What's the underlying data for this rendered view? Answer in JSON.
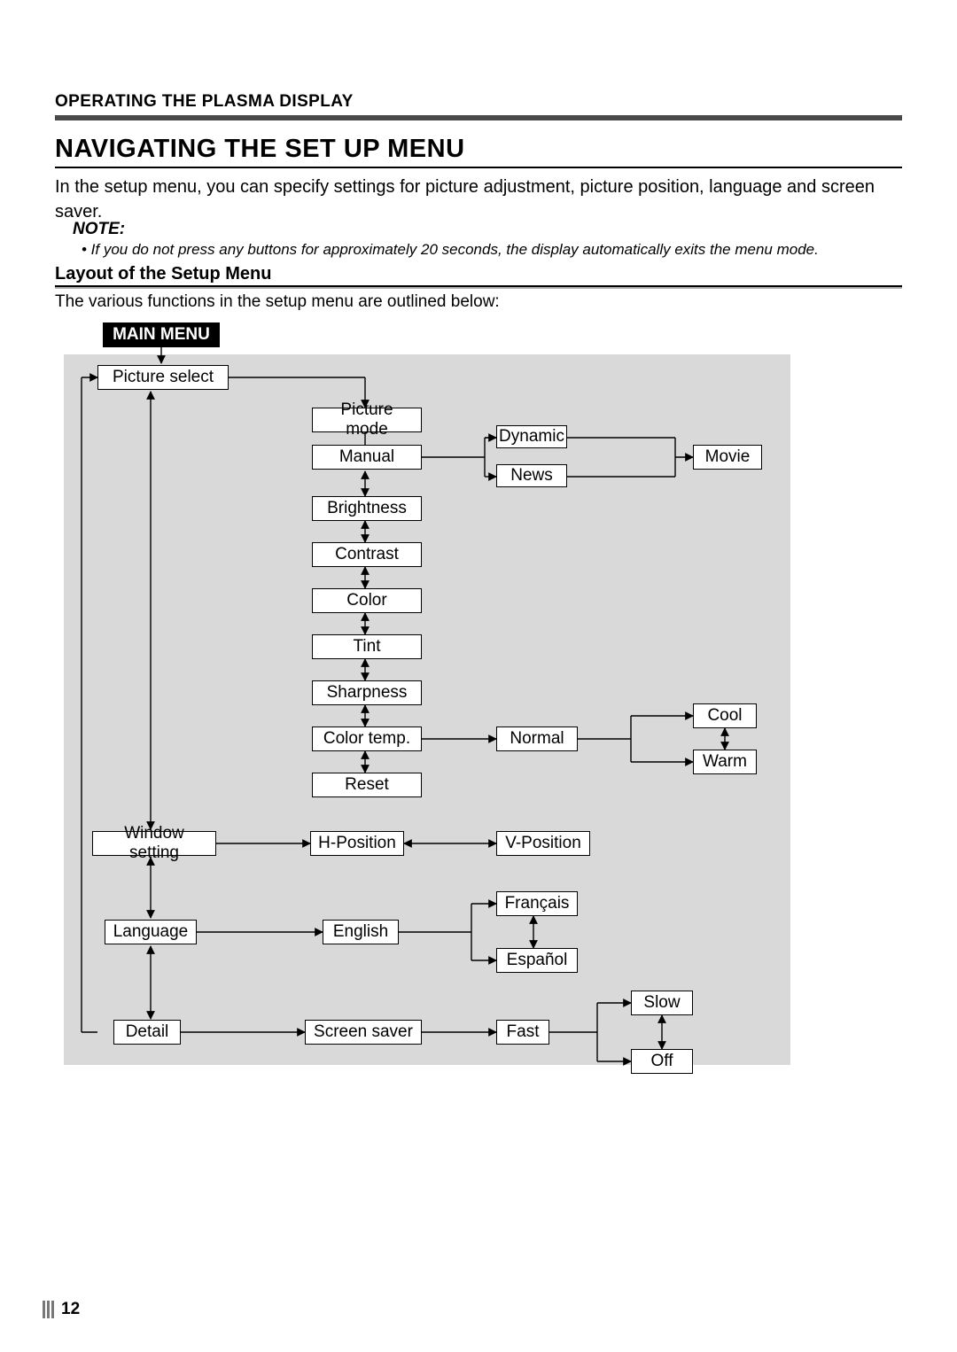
{
  "header": {
    "section": "OPERATING THE PLASMA DISPLAY",
    "title": "NAVIGATING THE SET UP MENU",
    "intro": "In the setup menu, you can specify settings for picture adjustment, picture position, language and screen saver.",
    "note_label": "NOTE:",
    "note_body": "• If you do not press any buttons for approximately 20 seconds, the display automatically exits the menu mode.",
    "h2": "Layout of the Setup Menu",
    "outline": "The various functions in the setup menu are outlined below:"
  },
  "nodes": {
    "main_menu": "MAIN MENU",
    "picture_select": "Picture select",
    "picture_mode": "Picture mode",
    "manual": "Manual",
    "dynamic": "Dynamic",
    "news": "News",
    "movie": "Movie",
    "brightness": "Brightness",
    "contrast": "Contrast",
    "color": "Color",
    "tint": "Tint",
    "sharpness": "Sharpness",
    "color_temp": "Color temp.",
    "normal": "Normal",
    "cool": "Cool",
    "warm": "Warm",
    "reset": "Reset",
    "window_setting": "Window setting",
    "h_position": "H-Position",
    "v_position": "V-Position",
    "language": "Language",
    "english": "English",
    "francais": "Français",
    "espanol": "Español",
    "detail": "Detail",
    "screen_saver": "Screen saver",
    "fast": "Fast",
    "slow": "Slow",
    "off": "Off"
  },
  "page_number": "12",
  "chart_data": {
    "type": "diagram",
    "title": "Layout of the Setup Menu",
    "root": "MAIN MENU",
    "structure": {
      "MAIN MENU": [
        "Picture select",
        "Window setting",
        "Language",
        "Detail"
      ],
      "Picture select": {
        "Picture mode": [
          "Manual",
          "Dynamic",
          "News",
          "Movie"
        ],
        "Manual_settings": [
          "Brightness",
          "Contrast",
          "Color",
          "Tint",
          "Sharpness",
          "Color temp.",
          "Reset"
        ],
        "Color temp.": [
          "Normal",
          "Cool",
          "Warm"
        ]
      },
      "Window setting": [
        "H-Position",
        "V-Position"
      ],
      "Language": [
        "English",
        "Français",
        "Español"
      ],
      "Detail": {
        "Screen saver": [
          "Fast",
          "Slow",
          "Off"
        ]
      }
    },
    "navigation_notes": "Double-headed arrows indicate bidirectional navigation between sibling items and between parent/child lists."
  }
}
